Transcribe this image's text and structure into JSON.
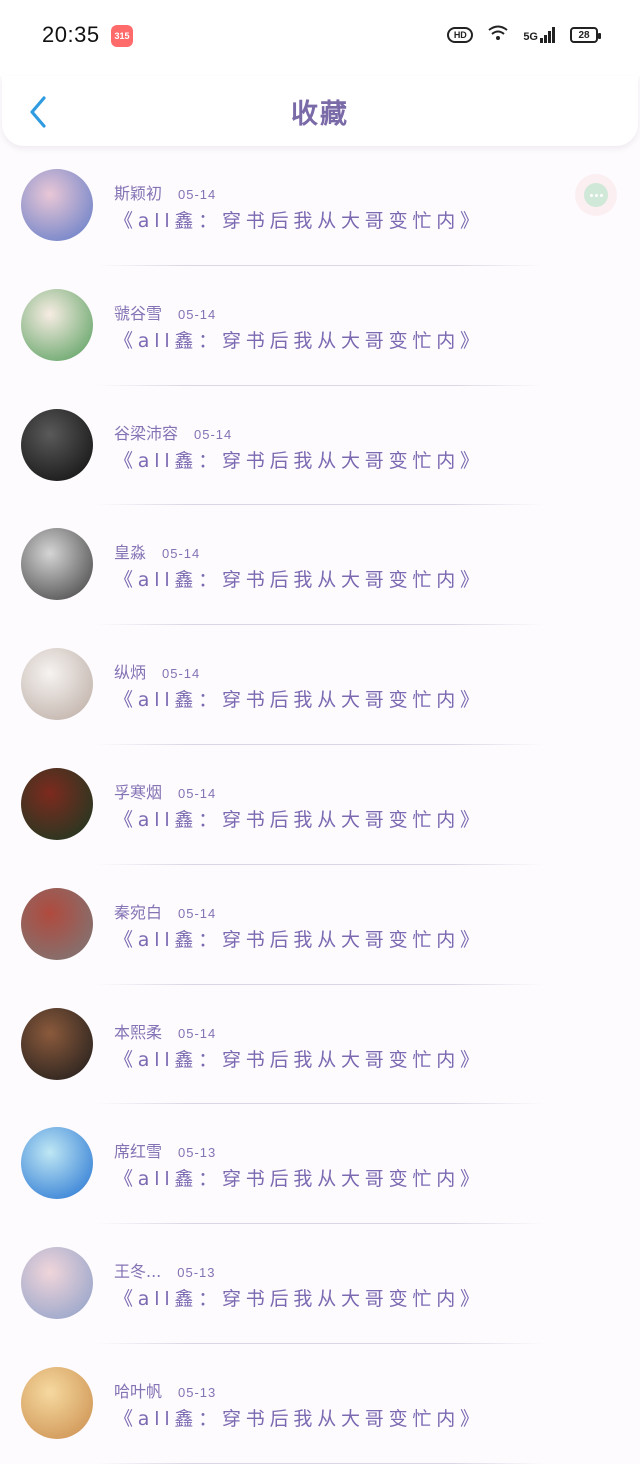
{
  "status_bar": {
    "time": "20:35",
    "app_badge": "315",
    "hd_label": "HD",
    "network_label": "5G",
    "battery_level": "28"
  },
  "header": {
    "title": "收藏",
    "back_icon": "chevron-left-icon"
  },
  "floating_button": {
    "icon": "more-dots-icon"
  },
  "favorites": [
    {
      "name": "斯颖初",
      "date": "05-14",
      "title": "《all鑫：穿书后我从大哥变忙内》",
      "avatar_colors": [
        "#e9c7d6",
        "#5b78c7"
      ]
    },
    {
      "name": "虢谷雪",
      "date": "05-14",
      "title": "《all鑫：穿书后我从大哥变忙内》",
      "avatar_colors": [
        "#f7ece3",
        "#4f9b57"
      ]
    },
    {
      "name": "谷梁沛容",
      "date": "05-14",
      "title": "《all鑫：穿书后我从大哥变忙内》",
      "avatar_colors": [
        "#5a5a5a",
        "#0c0c0c"
      ]
    },
    {
      "name": "皇淼",
      "date": "05-14",
      "title": "《all鑫：穿书后我从大哥变忙内》",
      "avatar_colors": [
        "#d5d5d5",
        "#3b3b3b"
      ]
    },
    {
      "name": "纵炳",
      "date": "05-14",
      "title": "《all鑫：穿书后我从大哥变忙内》",
      "avatar_colors": [
        "#f6f3f1",
        "#b9a9a0"
      ]
    },
    {
      "name": "孚寒烟",
      "date": "05-14",
      "title": "《all鑫：穿书后我从大哥变忙内》",
      "avatar_colors": [
        "#7d2a1e",
        "#153a22"
      ]
    },
    {
      "name": "秦宛白",
      "date": "05-14",
      "title": "《all鑫：穿书后我从大哥变忙内》",
      "avatar_colors": [
        "#b04a3e",
        "#7a7a7a"
      ]
    },
    {
      "name": "本熙柔",
      "date": "05-14",
      "title": "《all鑫：穿书后我从大哥变忙内》",
      "avatar_colors": [
        "#8b5a3c",
        "#1a1a1a"
      ]
    },
    {
      "name": "席红雪",
      "date": "05-13",
      "title": "《all鑫：穿书后我从大哥变忙内》",
      "avatar_colors": [
        "#bfe7f4",
        "#1f6fd1"
      ]
    },
    {
      "name": "王冬...",
      "date": "05-13",
      "title": "《all鑫：穿书后我从大哥变忙内》",
      "avatar_colors": [
        "#f0d5da",
        "#8a9ec8"
      ]
    },
    {
      "name": "哈叶帆",
      "date": "05-13",
      "title": "《all鑫：穿书后我从大哥变忙内》",
      "avatar_colors": [
        "#f6d9a0",
        "#c98b4a"
      ]
    }
  ]
}
